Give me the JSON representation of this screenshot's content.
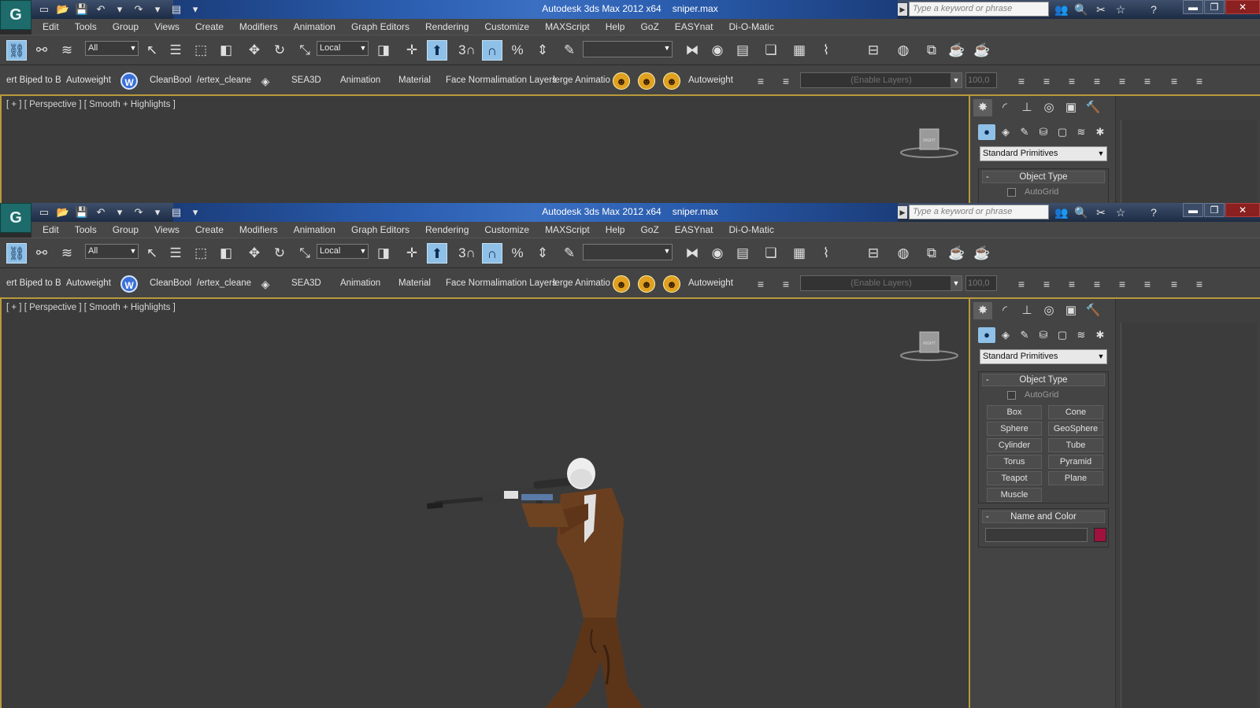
{
  "window": {
    "app_title": "Autodesk 3ds Max  2012 x64",
    "file_name": "sniper.max",
    "search_placeholder": "Type a keyword or phrase",
    "minimize_label": "▬",
    "restore_label": "❐",
    "close_label": "✕"
  },
  "app_logo_glyph": "G",
  "quick_access": {
    "new_icon": "▭",
    "open_icon": "📂",
    "save_icon": "💾",
    "undo_icon": "↶",
    "redo_icon": "↷",
    "project_icon": "▤",
    "more_icon": "▾"
  },
  "header_icons": {
    "community_icon": "👥",
    "search_icon": "🔍",
    "exchange_icon": "✂",
    "favorites_icon": "☆",
    "help_icon": "?"
  },
  "menu": {
    "items": [
      "Edit",
      "Tools",
      "Group",
      "Views",
      "Create",
      "Modifiers",
      "Animation",
      "Graph Editors",
      "Rendering",
      "Customize",
      "MAXScript",
      "Help",
      "GoZ",
      "EASYnat",
      "Di-O-Matic"
    ]
  },
  "main_toolbar": {
    "selection_filter": "All",
    "reference_coord": "Local",
    "snap_label": "3",
    "named_selection": ""
  },
  "custom_toolbar": {
    "labels": [
      "ert Biped to B",
      "Autoweight",
      "CleanBool",
      "/ertex_cleane",
      "SEA3D",
      "Animation",
      "Material",
      "Face Normal",
      "imation Layers",
      "lerge Animatio",
      "Autoweight"
    ],
    "layer_dropdown": "(Enable Layers)",
    "layer_value": "100,0"
  },
  "viewport": {
    "label": "[ + ] [ Perspective ] [ Smooth + Highlights ]",
    "viewcube_label": "RIGHT"
  },
  "command_panel": {
    "category_dropdown": "Standard Primitives",
    "object_type_title": "Object Type",
    "autogrid_label": "AutoGrid",
    "primitives": [
      "Box",
      "Cone",
      "Sphere",
      "GeoSphere",
      "Cylinder",
      "Tube",
      "Torus",
      "Pyramid",
      "Teapot",
      "Plane",
      "Muscle"
    ],
    "name_color_title": "Name and Color",
    "object_name": "",
    "object_color": "#a0123e",
    "collapse_symbol": "-"
  },
  "colors": {
    "accent_active": "#8fc1e8",
    "viewport_border": "#b89a3a",
    "title_blue": "#2a5cad"
  }
}
